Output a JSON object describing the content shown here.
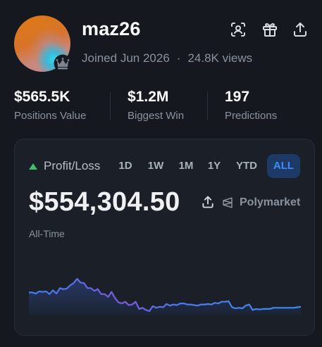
{
  "profile": {
    "username": "maz26",
    "joined": "Joined Jun 2026",
    "separator": "·",
    "views": "24.8K views"
  },
  "header_icons": [
    "scan-icon",
    "gift-icon",
    "share-icon"
  ],
  "stats": [
    {
      "value": "$565.5K",
      "label": "Positions Value"
    },
    {
      "value": "$1.2M",
      "label": "Biggest Win"
    },
    {
      "value": "197",
      "label": "Predictions"
    }
  ],
  "pnl": {
    "label": "Profit/Loss",
    "timeframes": [
      "1D",
      "1W",
      "1M",
      "1Y",
      "YTD",
      "ALL"
    ],
    "active_timeframe": "ALL",
    "amount": "$554,304.50",
    "brand": "Polymarket",
    "period": "All-Time",
    "colors": {
      "up": "#3fbf6a",
      "active_bg": "#1d3a66",
      "active_text": "#3b8cf5",
      "line_start": "#3b82f6",
      "line_mid": "#7c5ce0"
    }
  },
  "chart_data": {
    "type": "area",
    "title": "",
    "xlabel": "",
    "ylabel": "",
    "values": [
      20,
      20,
      18,
      22,
      21,
      22,
      17,
      24,
      18,
      28,
      26,
      27,
      33,
      37,
      45,
      38,
      37,
      28,
      28,
      23,
      26,
      17,
      17,
      12,
      21,
      10,
      2,
      0,
      3,
      -3,
      -2,
      3,
      -10,
      -8,
      -12,
      -14,
      -5,
      -8,
      -6,
      -7,
      -1,
      -4,
      -2,
      -3,
      0,
      0,
      -2,
      -2,
      -3,
      -4,
      -2,
      -2,
      -1,
      -2,
      1,
      0,
      3,
      3,
      4,
      -7,
      -9,
      -8,
      -9,
      -4,
      -2,
      -12,
      -10,
      -11,
      -10,
      -10,
      -10,
      -8,
      -8,
      -8,
      -8,
      -8,
      -8,
      -8,
      -7,
      -6
    ]
  }
}
